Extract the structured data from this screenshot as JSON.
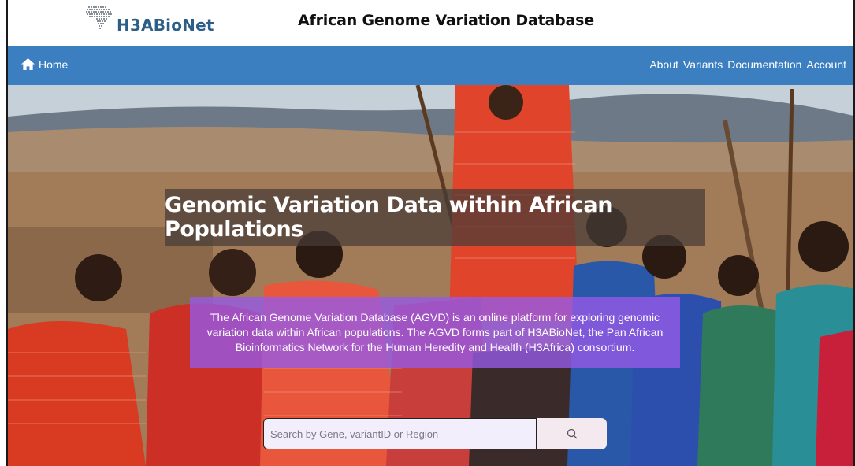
{
  "header": {
    "logo_text": "H3ABioNet",
    "site_title": "African Genome Variation Database"
  },
  "nav": {
    "home_label": "Home",
    "items": [
      "About",
      "Variants",
      "Documentation",
      "Account"
    ]
  },
  "hero": {
    "title": "Genomic Variation Data within African Populations",
    "description": "The African Genome Variation Database (AGVD) is an online platform for exploring genomic variation data within African populations. The AGVD forms part of H3ABioNet, the Pan African Bioinformatics Network for the Human Heredity and Health (H3Africa) consortium."
  },
  "search": {
    "placeholder": "Search by Gene, variantID or Region",
    "icon": "search-icon"
  },
  "colors": {
    "navbar": "#3b7fc1",
    "logo_text": "#2c5e87",
    "title_overlay": "rgba(70,60,55,0.72)",
    "description_overlay": "rgba(150,90,230,0.80)"
  }
}
